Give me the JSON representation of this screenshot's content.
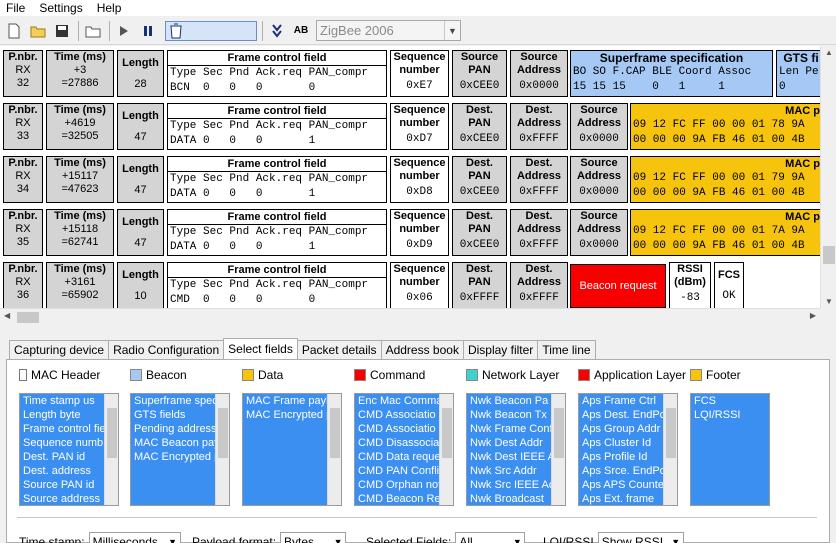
{
  "menu": [
    "File",
    "Settings",
    "Help"
  ],
  "toolbar": {
    "protocol": "ZigBee 2006",
    "icons": [
      "new-icon",
      "open-icon",
      "save-icon",
      "folder-icon",
      "play-icon",
      "pause-icon",
      "clear-icon",
      "scroll-icon",
      "ab-icon"
    ]
  },
  "headers": {
    "pnbr": "P.nbr.",
    "time": "Time (ms)",
    "length": "Length",
    "fcf": "Frame control field",
    "fcf_cols": "Type Sec Pnd Ack.req PAN_compr",
    "seq1": "Sequence",
    "seq2": "number",
    "src_pan1": "Source",
    "src_pan2": "PAN",
    "src_addr1": "Source",
    "src_addr2": "Address",
    "dest_pan1": "Dest.",
    "dest_pan2": "PAN",
    "dest_addr1": "Dest.",
    "dest_addr2": "Address",
    "superframe": "Superframe specification",
    "sf_cols": "BO SO F.CAP BLE Coord Assoc",
    "gts": "GTS fi",
    "gts_cols": "Len Pe",
    "mac_payload": "MAC p",
    "rssi1": "RSSI",
    "rssi2": "(dBm)",
    "fcs": "FCS"
  },
  "packets": [
    {
      "rx": "RX",
      "nbr": "32",
      "time_delta": "+3",
      "time_abs": "=27886",
      "length": "28",
      "fcf_vals": "BCN  0   0   0       0",
      "seq": "0xE7",
      "a1": "0xCEE0",
      "a2": "0x0000",
      "sf_vals": "15 15 15    0   1     1",
      "gts_vals": "0"
    },
    {
      "rx": "RX",
      "nbr": "33",
      "time_delta": "+4619",
      "time_abs": "=32505",
      "length": "47",
      "fcf_vals": "DATA 0   0   0       1",
      "seq": "0xD7",
      "a1": "0xCEE0",
      "a2": "0xFFFF",
      "a3": "0x0000",
      "hex1": "09 12 FC FF 00 00 01 78 9A",
      "hex2": "00 00 00 9A FB 46 01 00 4B"
    },
    {
      "rx": "RX",
      "nbr": "34",
      "time_delta": "+15117",
      "time_abs": "=47623",
      "length": "47",
      "fcf_vals": "DATA 0   0   0       1",
      "seq": "0xD8",
      "a1": "0xCEE0",
      "a2": "0xFFFF",
      "a3": "0x0000",
      "hex1": "09 12 FC FF 00 00 01 79 9A",
      "hex2": "00 00 00 9A FB 46 01 00 4B"
    },
    {
      "rx": "RX",
      "nbr": "35",
      "time_delta": "+15118",
      "time_abs": "=62741",
      "length": "47",
      "fcf_vals": "DATA 0   0   0       1",
      "seq": "0xD9",
      "a1": "0xCEE0",
      "a2": "0xFFFF",
      "a3": "0x0000",
      "hex1": "09 12 FC FF 00 00 01 7A 9A",
      "hex2": "00 00 00 9A FB 46 01 00 4B"
    },
    {
      "rx": "RX",
      "nbr": "36",
      "time_delta": "+3161",
      "time_abs": "=65902",
      "length": "10",
      "fcf_vals": "CMD  0   0   0       0",
      "seq": "0x06",
      "a1": "0xFFFF",
      "a2": "0xFFFF",
      "beacon": "Beacon request",
      "rssi": "-83",
      "fcs": "OK"
    }
  ],
  "tabs": [
    "Capturing device",
    "Radio Configuration",
    "Select fields",
    "Packet details",
    "Address book",
    "Display filter",
    "Time line"
  ],
  "active_tab": "Select fields",
  "groups": [
    {
      "label": "MAC Header",
      "color": "#ffffff",
      "items": [
        "Time stamp us",
        "Length byte",
        "Frame control fie",
        "Sequence numb",
        "Dest. PAN id",
        "Dest. address",
        "Source PAN id",
        "Source address"
      ]
    },
    {
      "label": "Beacon",
      "color": "#a5c8f5",
      "items": [
        "Superframe spec.",
        "GTS fields",
        "Pending addresses",
        "MAC Beacon payloa",
        "MAC Encrypted pay"
      ]
    },
    {
      "label": "Data",
      "color": "#f6c40d",
      "items": [
        "MAC Frame payload",
        "MAC Encrypted pay"
      ]
    },
    {
      "label": "Command",
      "color": "#f80000",
      "items": [
        "Enc Mac Comma",
        "CMD Associatio",
        "CMD Associatio",
        "CMD Disassocia",
        "CMD Data reque",
        "CMD PAN Conflic",
        "CMD Orphan not",
        "CMD Beacon Re"
      ]
    },
    {
      "label": "Network Layer",
      "color": "#3fd0d0",
      "items": [
        "Nwk Beacon Pa",
        "Nwk Beacon Tx",
        "Nwk Frame Conf",
        "Nwk Dest Addr",
        "Nwk Dest IEEE A",
        "Nwk Src Addr",
        "Nwk Src IEEE Ac",
        "Nwk Broadcast"
      ]
    },
    {
      "label": "Application Layer",
      "color": "#f80000",
      "items": [
        "Aps Frame Ctrl",
        "Aps Dest. EndPo",
        "Aps Group Addr",
        "Aps Cluster Id",
        "Aps Profile Id",
        "Aps Srce. EndPo",
        "Aps APS Counte",
        "Aps Ext. frame"
      ]
    },
    {
      "label": "Footer",
      "color": "#f6c40d",
      "items": [
        "FCS",
        "LQI/RSSI"
      ]
    }
  ],
  "bottom": {
    "timestamp_label": "Time stamp:",
    "timestamp_val": "Milliseconds",
    "payload_label": "Payload format:",
    "payload_val": "Bytes",
    "selected_label": "Selected Fields:",
    "selected_val": "All",
    "lqi_label": "LQI/RSSI",
    "lqi_val": "Show RSSI"
  }
}
